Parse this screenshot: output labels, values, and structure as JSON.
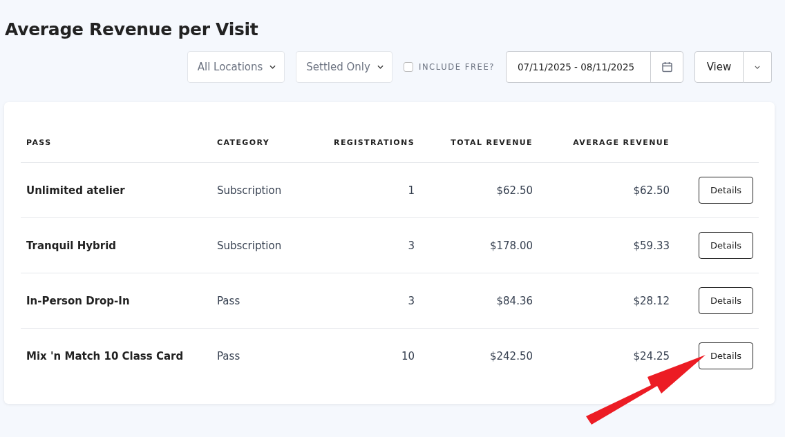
{
  "title": "Average Revenue per Visit",
  "filters": {
    "location": "All Locations",
    "status": "Settled Only",
    "include_free": {
      "label": "INCLUDE FREE?",
      "checked": false
    },
    "date_range": "07/11/2025 - 08/11/2025",
    "view_button": "View"
  },
  "table": {
    "columns": [
      "PASS",
      "CATEGORY",
      "REGISTRATIONS",
      "TOTAL REVENUE",
      "AVERAGE REVENUE"
    ],
    "rows": [
      {
        "pass": "Unlimited atelier",
        "category": "Subscription",
        "registrations": "1",
        "total_revenue": "$62.50",
        "average_revenue": "$62.50",
        "action": "Details"
      },
      {
        "pass": "Tranquil Hybrid",
        "category": "Subscription",
        "registrations": "3",
        "total_revenue": "$178.00",
        "average_revenue": "$59.33",
        "action": "Details"
      },
      {
        "pass": "In-Person Drop-In",
        "category": "Pass",
        "registrations": "3",
        "total_revenue": "$84.36",
        "average_revenue": "$28.12",
        "action": "Details"
      },
      {
        "pass": "Mix 'n Match 10 Class Card",
        "category": "Pass",
        "registrations": "10",
        "total_revenue": "$242.50",
        "average_revenue": "$24.25",
        "action": "Details"
      }
    ]
  }
}
